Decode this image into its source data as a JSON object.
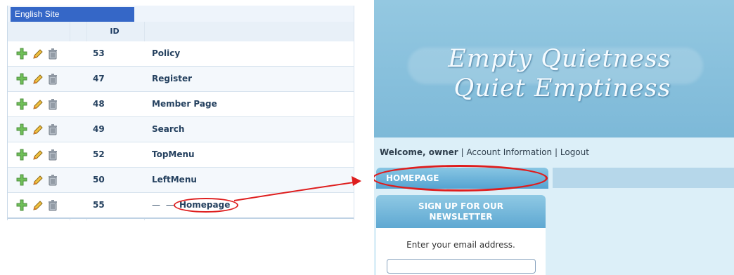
{
  "admin": {
    "site_tab": "English Site",
    "header": {
      "id": "ID"
    },
    "rows": [
      {
        "id": "53",
        "name": "Policy"
      },
      {
        "id": "47",
        "name": "Register"
      },
      {
        "id": "48",
        "name": "Member Page"
      },
      {
        "id": "49",
        "name": "Search"
      },
      {
        "id": "52",
        "name": "TopMenu"
      },
      {
        "id": "50",
        "name": "LeftMenu"
      },
      {
        "id": "55",
        "name": "Homepage",
        "prefix": "— —"
      }
    ],
    "icons": [
      "plus-icon",
      "edit-icon",
      "trash-icon"
    ]
  },
  "site": {
    "title_line_1": "Empty Quietness",
    "title_line_2": "Quiet Emptiness",
    "welcome_text": "Welcome, owner",
    "separator": "|",
    "account_link": "Account Information",
    "logout_link": "Logout",
    "menu_item": "HOMEPAGE",
    "newsletter_title_line_1": "SIGN UP FOR OUR",
    "newsletter_title_line_2": "NEWSLETTER",
    "newsletter_prompt": "Enter your email address.",
    "email_value": ""
  },
  "colors": {
    "admin_tab": "#3567c7",
    "highlight": "#de1e1e",
    "site_background": "#dceff8",
    "banner": "#7db9d8",
    "menu": "#55a3d1"
  }
}
